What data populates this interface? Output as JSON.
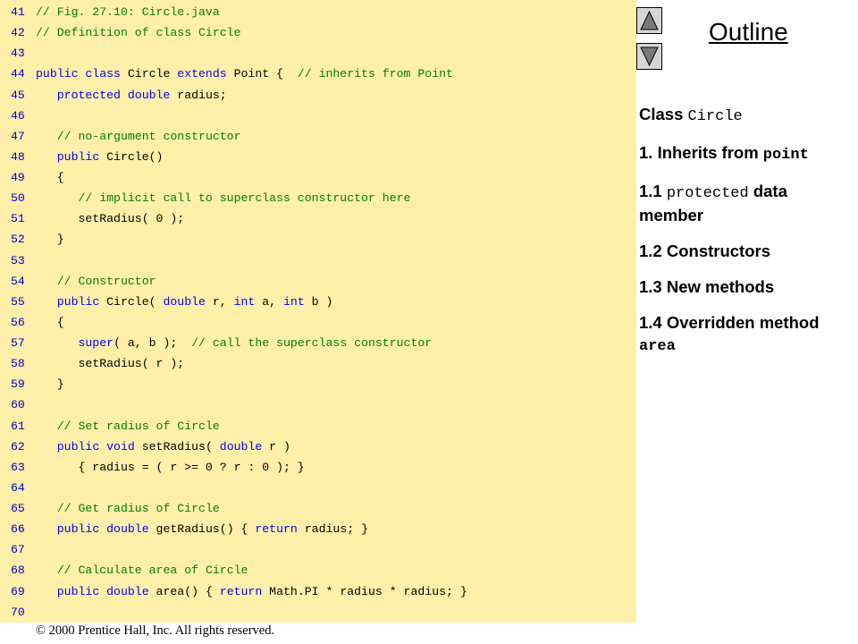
{
  "code_lines": [
    {
      "num": "41",
      "parts": [
        {
          "c": "// Fig. 27.10: Circle.java",
          "k": "c"
        }
      ]
    },
    {
      "num": "42",
      "parts": [
        {
          "c": "// Definition of class Circle",
          "k": "c"
        }
      ]
    },
    {
      "num": "43",
      "parts": []
    },
    {
      "num": "44",
      "parts": [
        {
          "c": "public class",
          "k": "k"
        },
        {
          "c": " Circle ",
          "k": "t"
        },
        {
          "c": "extends",
          "k": "k"
        },
        {
          "c": " Point {  ",
          "k": "t"
        },
        {
          "c": "// inherits from Point",
          "k": "c"
        }
      ]
    },
    {
      "num": "45",
      "parts": [
        {
          "c": "   ",
          "k": "t"
        },
        {
          "c": "protected double",
          "k": "k"
        },
        {
          "c": " radius;",
          "k": "t"
        }
      ]
    },
    {
      "num": "46",
      "parts": []
    },
    {
      "num": "47",
      "parts": [
        {
          "c": "   ",
          "k": "t"
        },
        {
          "c": "// no-argument constructor",
          "k": "c"
        }
      ]
    },
    {
      "num": "48",
      "parts": [
        {
          "c": "   ",
          "k": "t"
        },
        {
          "c": "public",
          "k": "k"
        },
        {
          "c": " Circle()",
          "k": "t"
        }
      ]
    },
    {
      "num": "49",
      "parts": [
        {
          "c": "   {",
          "k": "t"
        }
      ]
    },
    {
      "num": "50",
      "parts": [
        {
          "c": "      ",
          "k": "t"
        },
        {
          "c": "// implicit call to superclass constructor here",
          "k": "c"
        }
      ]
    },
    {
      "num": "51",
      "parts": [
        {
          "c": "      setRadius( 0 );",
          "k": "t"
        }
      ]
    },
    {
      "num": "52",
      "parts": [
        {
          "c": "   }",
          "k": "t"
        }
      ]
    },
    {
      "num": "53",
      "parts": []
    },
    {
      "num": "54",
      "parts": [
        {
          "c": "   ",
          "k": "t"
        },
        {
          "c": "// Constructor",
          "k": "c"
        }
      ]
    },
    {
      "num": "55",
      "parts": [
        {
          "c": "   ",
          "k": "t"
        },
        {
          "c": "public",
          "k": "k"
        },
        {
          "c": " Circle( ",
          "k": "t"
        },
        {
          "c": "double",
          "k": "k"
        },
        {
          "c": " r, ",
          "k": "t"
        },
        {
          "c": "int",
          "k": "k"
        },
        {
          "c": " a, ",
          "k": "t"
        },
        {
          "c": "int",
          "k": "k"
        },
        {
          "c": " b )",
          "k": "t"
        }
      ]
    },
    {
      "num": "56",
      "parts": [
        {
          "c": "   {",
          "k": "t"
        }
      ]
    },
    {
      "num": "57",
      "parts": [
        {
          "c": "      ",
          "k": "t"
        },
        {
          "c": "super",
          "k": "k"
        },
        {
          "c": "( a, b );  ",
          "k": "t"
        },
        {
          "c": "// call the superclass constructor",
          "k": "c"
        }
      ]
    },
    {
      "num": "58",
      "parts": [
        {
          "c": "      setRadius( r );",
          "k": "t"
        }
      ]
    },
    {
      "num": "59",
      "parts": [
        {
          "c": "   }",
          "k": "t"
        }
      ]
    },
    {
      "num": "60",
      "parts": []
    },
    {
      "num": "61",
      "parts": [
        {
          "c": "   ",
          "k": "t"
        },
        {
          "c": "// Set radius of Circle",
          "k": "c"
        }
      ]
    },
    {
      "num": "62",
      "parts": [
        {
          "c": "   ",
          "k": "t"
        },
        {
          "c": "public void",
          "k": "k"
        },
        {
          "c": " setRadius( ",
          "k": "t"
        },
        {
          "c": "double",
          "k": "k"
        },
        {
          "c": " r )",
          "k": "t"
        }
      ]
    },
    {
      "num": "63",
      "parts": [
        {
          "c": "      { radius = ( r >= 0 ? r : 0 ); }",
          "k": "t"
        }
      ]
    },
    {
      "num": "64",
      "parts": []
    },
    {
      "num": "65",
      "parts": [
        {
          "c": "   ",
          "k": "t"
        },
        {
          "c": "// Get radius of Circle",
          "k": "c"
        }
      ]
    },
    {
      "num": "66",
      "parts": [
        {
          "c": "   ",
          "k": "t"
        },
        {
          "c": "public double",
          "k": "k"
        },
        {
          "c": " getRadius() { ",
          "k": "t"
        },
        {
          "c": "return",
          "k": "k"
        },
        {
          "c": " radius; }",
          "k": "t"
        }
      ]
    },
    {
      "num": "67",
      "parts": []
    },
    {
      "num": "68",
      "parts": [
        {
          "c": "   ",
          "k": "t"
        },
        {
          "c": "// Calculate area of Circle",
          "k": "c"
        }
      ]
    },
    {
      "num": "69",
      "parts": [
        {
          "c": "   ",
          "k": "t"
        },
        {
          "c": "public double",
          "k": "k"
        },
        {
          "c": " area() { ",
          "k": "t"
        },
        {
          "c": "return",
          "k": "k"
        },
        {
          "c": " Math.PI * radius * radius; }",
          "k": "t"
        }
      ]
    },
    {
      "num": "70",
      "parts": []
    }
  ],
  "outline": {
    "title": "Outline",
    "item1": {
      "text": "Class ",
      "code": "Circle"
    },
    "item2": {
      "text": "1. Inherits from ",
      "code": "point"
    },
    "item3": {
      "prefix": "1.1 ",
      "code": "protected",
      "text": " data member"
    },
    "item4": "1.2 Constructors",
    "item5": "1.3 New methods",
    "item6": {
      "text": "1.4 Overridden method ",
      "code": "area"
    }
  },
  "nav": {
    "up_icon": "up-arrow-icon",
    "down_icon": "down-arrow-icon"
  },
  "footer": "© 2000 Prentice Hall, Inc.  All rights reserved.",
  "colors": {
    "code_bg": "#FFEFA8",
    "keyword": "#0000FF",
    "comment": "#008000",
    "line_number": "#0000CC",
    "nav_button": "#D6D6D6"
  }
}
